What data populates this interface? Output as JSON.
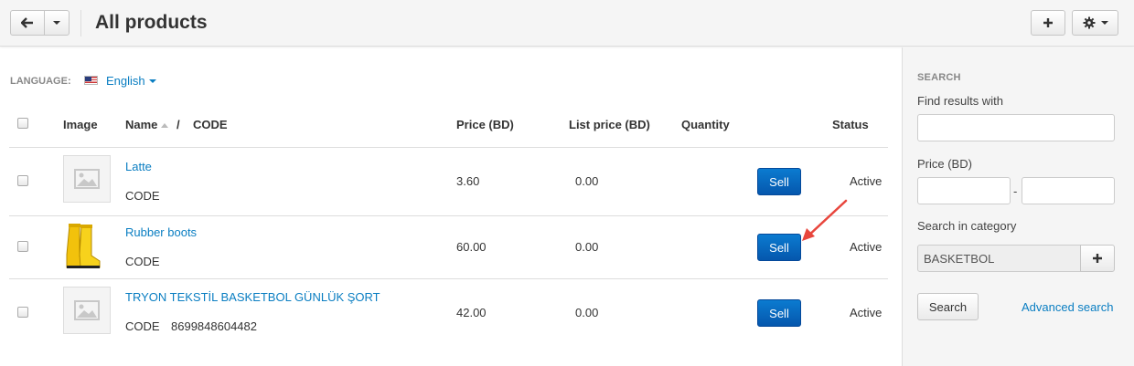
{
  "header": {
    "title": "All products"
  },
  "language": {
    "label": "LANGUAGE:",
    "value": "English"
  },
  "table": {
    "columns": {
      "image": "Image",
      "name": "Name",
      "name_code_sep": "/",
      "code": "CODE",
      "price": "Price (BD)",
      "list_price": "List price (BD)",
      "quantity": "Quantity",
      "status": "Status"
    },
    "rows": [
      {
        "name": "Latte",
        "code_label": "CODE",
        "code_value": "",
        "price": "3.60",
        "list_price": "0.00",
        "action": "Sell",
        "status": "Active",
        "image": "placeholder"
      },
      {
        "name": "Rubber boots",
        "code_label": "CODE",
        "code_value": "",
        "price": "60.00",
        "list_price": "0.00",
        "action": "Sell",
        "status": "Active",
        "image": "yellow-rubber-boots"
      },
      {
        "name": "TRYON TEKSTİL BASKETBOL GÜNLÜK ŞORT",
        "code_label": "CODE",
        "code_value": "8699848604482",
        "price": "42.00",
        "list_price": "0.00",
        "action": "Sell",
        "status": "Active",
        "image": "placeholder"
      }
    ]
  },
  "sidebar": {
    "heading": "SEARCH",
    "find_label": "Find results with",
    "find_value": "",
    "price_label": "Price (BD)",
    "price_sep": "-",
    "category_label": "Search in category",
    "category_value": "BASKETBOL",
    "search_button": "Search",
    "advanced_link": "Advanced search"
  },
  "colors": {
    "link": "#0a7ec2",
    "sell_button": "#0668c2",
    "annotation_arrow": "#e8463d"
  }
}
